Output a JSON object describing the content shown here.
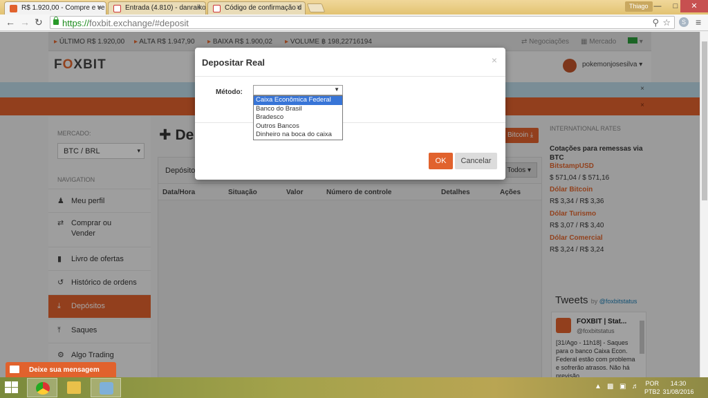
{
  "browser": {
    "tabs": [
      {
        "title": "R$ 1.920,00 - Compre e ve",
        "active": true
      },
      {
        "title": "Entrada (4.810) - danraiko",
        "active": false
      },
      {
        "title": "Código de confirmação d",
        "active": false
      }
    ],
    "user": "Thiago",
    "url_scheme": "https://",
    "url_rest": "foxbit.exchange/#deposit"
  },
  "ticker": {
    "last_label": "ÚLTIMO",
    "last_value": "R$ 1.920,00",
    "high_label": "ALTA",
    "high_value": "R$ 1.947,90",
    "low_label": "BAIXA",
    "low_value": "R$ 1.900,02",
    "volume_label": "VOLUME",
    "volume_value": "฿ 198,22716194",
    "negotiations": "Negociações",
    "market": "Mercado"
  },
  "header": {
    "logo_pre": "F",
    "logo_o": "O",
    "logo_post": "XBIT",
    "username": "pokemonjosesilva"
  },
  "sidebar": {
    "market_label": "MERCADO:",
    "market_value": "BTC / BRL",
    "nav_label": "NAVIGATION",
    "items": [
      {
        "label": "Meu perfil",
        "icon": "user-icon"
      },
      {
        "label": "Comprar ou Vender",
        "icon": "shuffle-icon"
      },
      {
        "label": "Livro de ofertas",
        "icon": "book-icon"
      },
      {
        "label": "Histórico de ordens",
        "icon": "history-icon"
      },
      {
        "label": "Depósitos",
        "icon": "download-icon",
        "active": true
      },
      {
        "label": "Saques",
        "icon": "upload-icon"
      },
      {
        "label": "Algo Trading",
        "icon": "gear-icon"
      }
    ]
  },
  "main": {
    "title": "De",
    "bitcoin_button": "Bitcoin",
    "box_title": "Depósito",
    "filter": "Todos",
    "columns": [
      "Data/Hora",
      "Situação",
      "Valor",
      "Número de controle",
      "Detalhes",
      "Ações"
    ]
  },
  "rates": {
    "heading": "INTERNATIONAL RATES",
    "subtitle": "Cotações para remessas via BTC",
    "items": [
      {
        "name": "BitstampUSD",
        "value": "$ 571,04 / $ 571,16"
      },
      {
        "name": "Dólar Bitcoin",
        "value": "R$ 3,34 / R$ 3,36"
      },
      {
        "name": "Dólar Turismo",
        "value": "R$ 3,07 / R$ 3,40"
      },
      {
        "name": "Dólar Comercial",
        "value": "R$ 3,24 / R$ 3,24"
      }
    ]
  },
  "tweets": {
    "title": "Tweets",
    "by": "by",
    "handle_link": "@foxbitstatus",
    "tweet": {
      "name": "FOXBIT | Stat...",
      "handle": "@foxbitstatus",
      "text": "[31/Ago - 11h18] - Saques para o banco Caixa Econ. Federal estão com problema e sofrerão atrasos. Não há previsão."
    }
  },
  "modal": {
    "title": "Depositar Real",
    "close": "×",
    "method_label": "Método:",
    "options": [
      "Caixa Econômica Federal",
      "Banco do Brasil",
      "Bradesco",
      "Outros Bancos",
      "Dinheiro na boca do caixa"
    ],
    "ok": "OK",
    "cancel": "Cancelar"
  },
  "chat": {
    "label": "Deixe sua mensagem"
  },
  "taskbar": {
    "lang_top": "POR",
    "lang_bottom": "PTB2",
    "time": "14:30",
    "date": "31/08/2016"
  },
  "colors": {
    "accent": "#e1622d",
    "band_blue": "#bcd9e7",
    "selected_option": "#3875d7"
  }
}
